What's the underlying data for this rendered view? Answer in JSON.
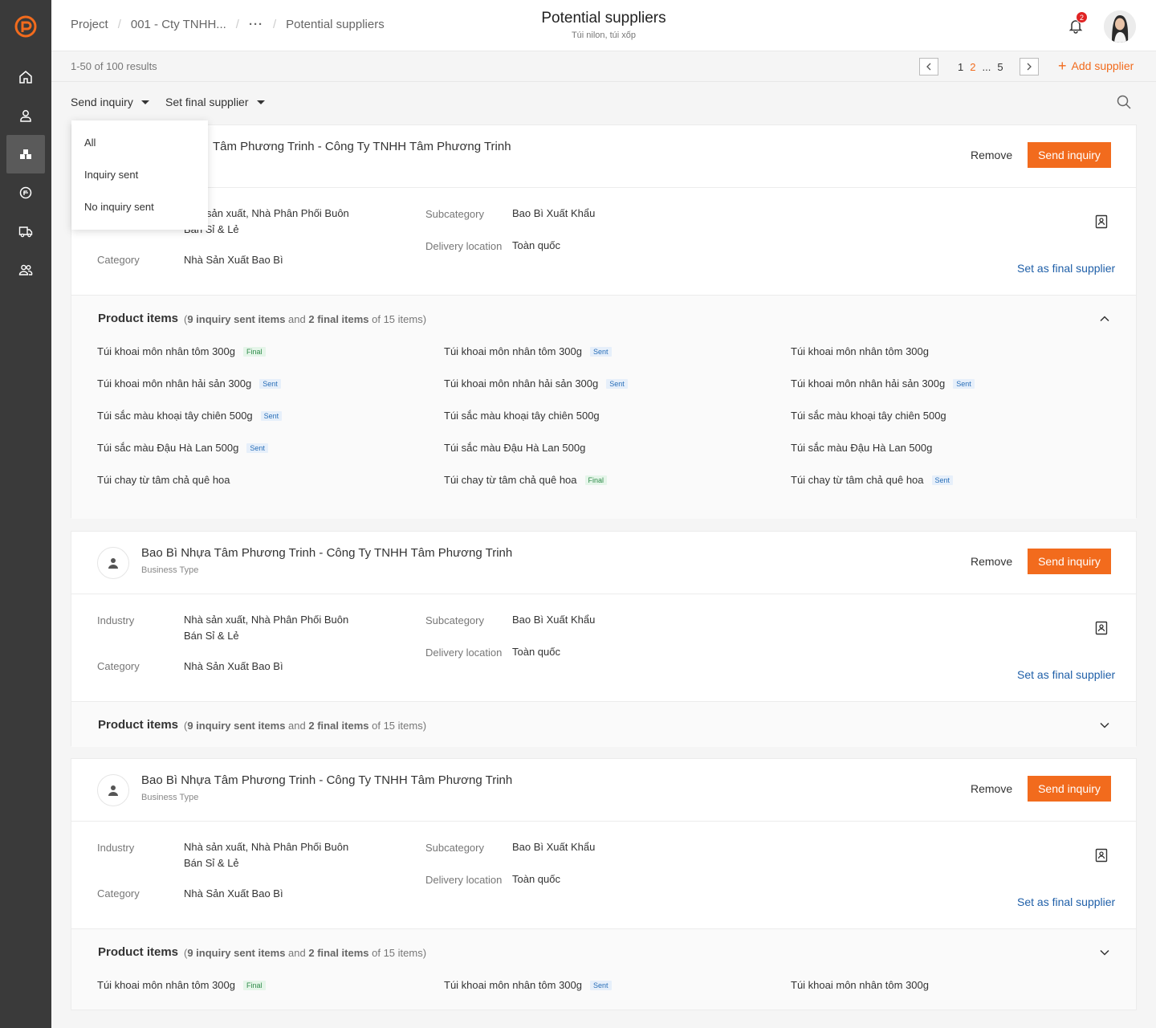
{
  "breadcrumb": {
    "project": "Project",
    "company": "001 - Cty TNHH...",
    "more": "···",
    "current": "Potential suppliers"
  },
  "header": {
    "title": "Potential suppliers",
    "subtitle": "Túi nilon, túi xốp",
    "notification_count": "2"
  },
  "results": {
    "count": "1-50 of 100 results",
    "pages": [
      "1",
      "2",
      "...",
      "5"
    ],
    "active_page": "2",
    "add_label": "Add supplier"
  },
  "filters": {
    "send_inquiry": "Send inquiry",
    "set_final": "Set final supplier",
    "dropdown": [
      "All",
      "Inquiry sent",
      "No inquiry sent"
    ]
  },
  "colors": {
    "accent": "#f26b1d",
    "sidebar": "#3a3a3a",
    "link": "#1f5fa8"
  },
  "labels": {
    "remove": "Remove",
    "send_inquiry": "Send inquiry",
    "set_final": "Set as final supplier",
    "industry": "Industry",
    "category": "Category",
    "subcategory": "Subcategory",
    "delivery": "Delivery location",
    "product_items": "Product items"
  },
  "card1": {
    "name": "Bao Bì Nhựa Tâm Phương Trinh - Công Ty TNHH Tâm Phương Trinh",
    "name_visible": "Tâm Phương Trinh - Công Ty TNHH Tâm Phương Trinh",
    "industry_visible": "sản xuất, Nhà Phân Phối Buôn",
    "industry_line2_visible": "Bán Sỉ & Lẻ",
    "category": "Nhà Sản Xuất Bao Bì",
    "subcategory": "Bao Bì Xuất Khẩu",
    "delivery": "Toàn quốc"
  },
  "card2": {
    "name": "Bao Bì Nhựa Tâm Phương Trinh - Công Ty TNHH Tâm Phương Trinh",
    "type": "Business Type",
    "industry_l1": "Nhà sản xuất, Nhà Phân Phối Buôn",
    "industry_l2": "Bán Sỉ & Lẻ",
    "category": "Nhà Sản Xuất Bao Bì",
    "subcategory": "Bao Bì Xuất Khẩu",
    "delivery": "Toàn quốc"
  },
  "card3": {
    "name": "Bao Bì Nhựa Tâm Phương Trinh - Công Ty TNHH Tâm Phương Trinh",
    "type": "Business Type",
    "industry_l1": "Nhà sản xuất, Nhà Phân Phối Buôn",
    "industry_l2": "Bán Sỉ & Lẻ",
    "category": "Nhà Sản Xuất Bao Bì",
    "subcategory": "Bao Bì Xuất Khẩu",
    "delivery": "Toàn quốc"
  },
  "items_meta": {
    "open": "(",
    "sent": "9 inquiry sent items",
    "and": " and ",
    "final": "2 final items",
    "of": " of 15 items)"
  },
  "tags": {
    "sent": "Sent",
    "final": "Final"
  },
  "product_items": [
    [
      "Túi khoai môn nhân tôm 300g",
      "Túi khoai môn nhân tôm 300g",
      "Túi khoai môn nhân tôm 300g"
    ],
    [
      "Túi khoai môn nhân hải sản 300g",
      "Túi khoai môn nhân hải sản 300g",
      "Túi khoai môn nhân hải sản 300g"
    ],
    [
      "Túi sắc màu khoại tây chiên 500g",
      "Túi sắc màu khoại tây chiên 500g",
      "Túi sắc màu khoại tây chiên 500g"
    ],
    [
      "Túi sắc màu Đậu Hà Lan 500g",
      "Túi sắc màu Đậu Hà Lan 500g",
      "Túi sắc màu Đậu Hà Lan 500g"
    ],
    [
      "Túi chay từ tâm chả quê hoa",
      "Túi chay từ tâm chả quê hoa",
      "Túi chay từ tâm chả quê hoa"
    ]
  ]
}
